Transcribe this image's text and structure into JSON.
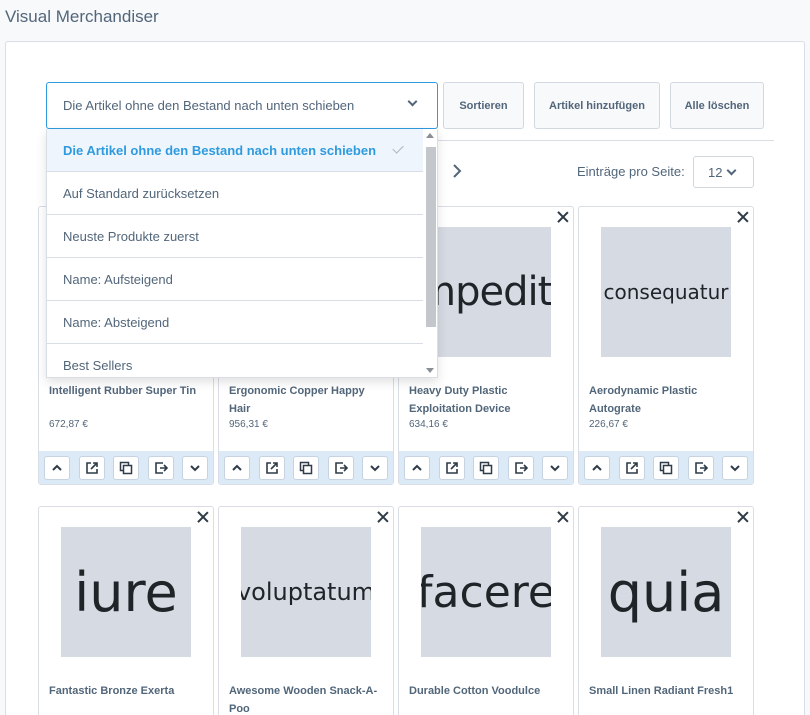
{
  "page": {
    "title": "Visual Merchandiser"
  },
  "toolbar": {
    "sort_select_value": "Die Artikel ohne den Bestand nach unten schieben",
    "sort_button": "Sortieren",
    "add_button": "Artikel hinzufügen",
    "clear_button": "Alle löschen"
  },
  "dropdown": {
    "options": [
      "Die Artikel ohne den Bestand nach unten schieben",
      "Auf Standard zurücksetzen",
      "Neuste Produkte zuerst",
      "Name: Aufsteigend",
      "Name: Absteigend",
      "Best Sellers"
    ]
  },
  "pagination": {
    "per_page_label": "Einträge pro Seite:",
    "per_page_value": "12"
  },
  "products": [
    {
      "name": "Intelligent Rubber Super Tin",
      "price": "672,87 €",
      "image_text": ""
    },
    {
      "name": "Ergonomic Copper Happy Hair",
      "price": "956,31 €",
      "image_text": ""
    },
    {
      "name": "Heavy Duty Plastic Exploitation Device",
      "price": "634,16 €",
      "image_text": "impedit"
    },
    {
      "name": "Aerodynamic Plastic Autograte",
      "price": "226,67 €",
      "image_text": "consequatur"
    },
    {
      "name": "Fantastic Bronze Exerta",
      "price": "",
      "image_text": "iure"
    },
    {
      "name": "Awesome Wooden Snack-A-Poo",
      "price": "",
      "image_text": "voluptatum"
    },
    {
      "name": "Durable Cotton Voodulce",
      "price": "",
      "image_text": "facere"
    },
    {
      "name": "Small Linen Radiant Fresh1",
      "price": "",
      "image_text": "quia"
    }
  ],
  "colors": {
    "accent": "#2f9bde",
    "toolbar_bg": "#dceaf7",
    "image_bg": "#d6dae2"
  }
}
